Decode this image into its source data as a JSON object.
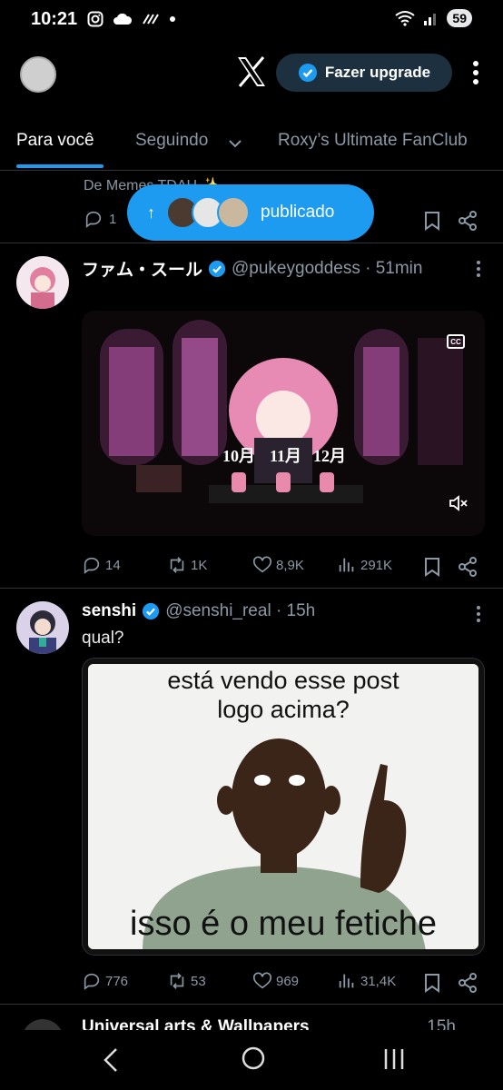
{
  "status_bar": {
    "time": "10:21",
    "battery": "59"
  },
  "header": {
    "upgrade_label": "Fazer upgrade"
  },
  "tabs": [
    {
      "label": "Para você",
      "active": true
    },
    {
      "label": "Seguindo",
      "active": false
    },
    {
      "label": "Roxy’s Ultimate FanClub",
      "active": false
    }
  ],
  "previous_post": {
    "text": "De Memes TDAH ✨",
    "replies": "1"
  },
  "posted_pill": {
    "label": "publicado"
  },
  "tweets": [
    {
      "name": "ファム・スール",
      "handle": "@pukeygoddess · 51min",
      "text": "",
      "media": {
        "type": "video",
        "cc_label": "CC",
        "dates": [
          "10月",
          "11月",
          "12月"
        ]
      },
      "stats": {
        "replies": "14",
        "reposts": "1K",
        "likes": "8,9K",
        "views": "291K"
      }
    },
    {
      "name": "senshi",
      "handle": "@senshi_real · 15h",
      "text": "qual?",
      "media": {
        "type": "image",
        "top_text": "está vendo esse post logo acima?",
        "bottom_text": "isso é o meu fetiche"
      },
      "stats": {
        "replies": "776",
        "reposts": "53",
        "likes": "969",
        "views": "31,4K"
      }
    }
  ],
  "next_post": {
    "name": "Universal arts & Wallpapers",
    "time": "15h"
  },
  "colors": {
    "accent": "#1d9bf0",
    "background": "#000000",
    "muted": "#8b98a5"
  }
}
